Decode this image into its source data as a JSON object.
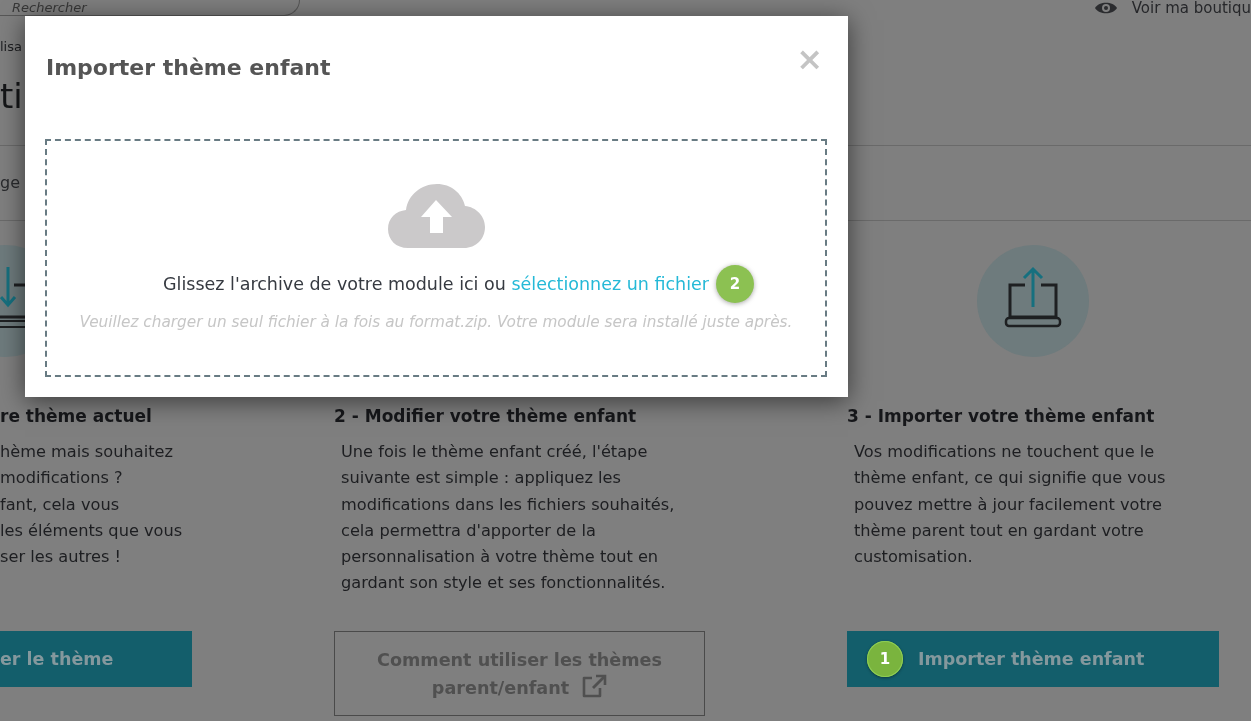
{
  "header": {
    "search": {
      "placeholder": "Rechercher"
    },
    "shop_link": "Voir ma boutiqu"
  },
  "breadcrumb": "lisa",
  "page_title": "ti",
  "tab": "ge",
  "steps": [
    {
      "title": "re thème actuel",
      "description": [
        "hème mais souhaitez",
        "modifications ?",
        "fant, cela vous",
        "les éléments que vous",
        "ser les autres !"
      ],
      "button": {
        "kind": "primary",
        "label": "er le thème"
      }
    },
    {
      "title": "2 - Modifier votre thème enfant",
      "description": [
        "Une fois le thème enfant créé, l'étape",
        "suivante est simple : appliquez les",
        "modifications dans les fichiers souhaités,",
        "cela permettra d'apporter de la",
        "personnalisation à votre thème tout en",
        "gardant son style et ses fonctionnalités."
      ],
      "button": {
        "kind": "outline",
        "label": "Comment utiliser les thèmes parent/enfant",
        "external": true
      }
    },
    {
      "title": "3 - Importer votre thème enfant",
      "description": [
        "Vos modifications ne touchent que le",
        "thème enfant, ce qui signifie que vous",
        "pouvez mettre à jour facilement votre",
        "thème parent tout en gardant votre",
        "customisation."
      ],
      "button": {
        "kind": "primary",
        "label": "Importer thème enfant",
        "badge": "1"
      }
    }
  ],
  "modal": {
    "title": "Importer thème enfant",
    "close": "×",
    "dropzone": {
      "text": "Glissez l'archive de votre module ici ou",
      "link": "sélectionnez un fichier",
      "badge": "2",
      "hint": "Veuillez charger un seul fichier à la fois au format.zip. Votre module sera installé juste après."
    }
  }
}
